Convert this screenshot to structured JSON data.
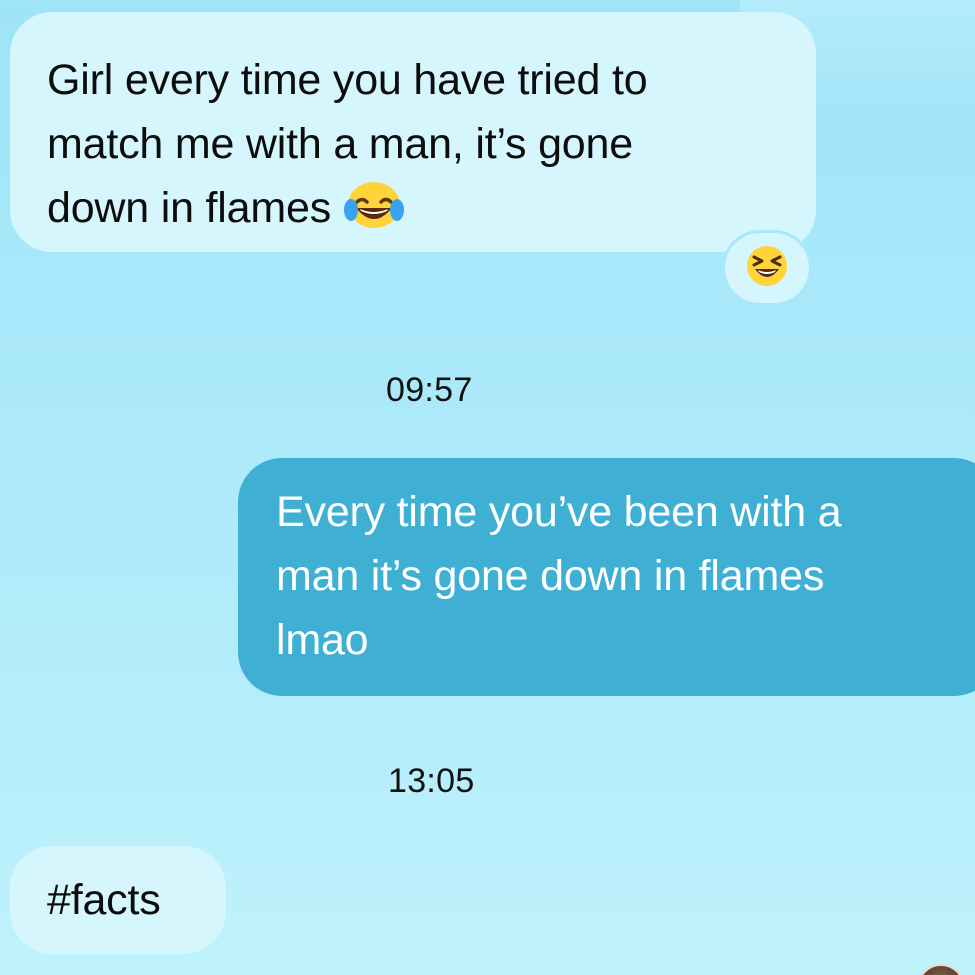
{
  "conversation": {
    "messages": [
      {
        "direction": "incoming",
        "lines": [
          "Girl every time you have tried to",
          "match me with a man, it’s gone",
          "down in flames"
        ],
        "emoji": "face-with-tears-of-joy-icon",
        "reaction_emoji": "grinning-squinting-face-icon"
      },
      {
        "timestamp": "09:57"
      },
      {
        "direction": "outgoing",
        "lines": [
          "Every time you’ve been with a",
          "man it’s gone down in flames",
          "lmao"
        ]
      },
      {
        "timestamp": "13:05"
      },
      {
        "direction": "incoming",
        "lines": [
          "#facts"
        ]
      }
    ]
  },
  "colors": {
    "background_top": "#9fe3f7",
    "background_bottom": "#bff2fc",
    "incoming_bubble": "#d6f6fd",
    "outgoing_bubble": "#3fb0d3",
    "outgoing_text": "#ffffff"
  }
}
